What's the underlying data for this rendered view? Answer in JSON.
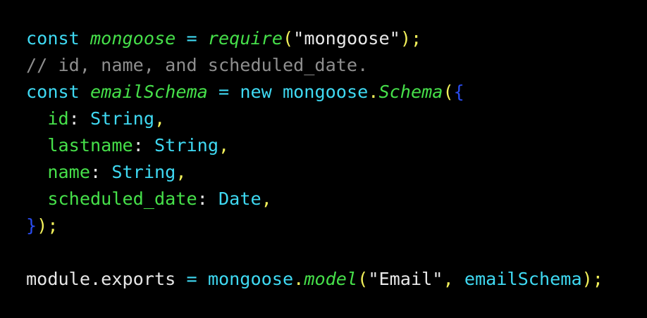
{
  "colors": {
    "background": "#000000",
    "keyword": "#3fd9f2",
    "identifier": "#46e04a",
    "string": "#e8e8e8",
    "punctuation": "#f2f05a",
    "comment": "#8e8e8e",
    "type": "#3fd9f2",
    "brace": "#2a4cf0",
    "plain": "#e6e6e6"
  },
  "lines": [
    [
      {
        "t": "const",
        "c": "keyword"
      },
      {
        "t": " ",
        "c": "plain"
      },
      {
        "t": "mongoose",
        "c": "identifier",
        "i": true
      },
      {
        "t": " = ",
        "c": "keyword"
      },
      {
        "t": "require",
        "c": "identifier",
        "i": true
      },
      {
        "t": "(",
        "c": "punctuation"
      },
      {
        "t": "\"mongoose\"",
        "c": "string"
      },
      {
        "t": ");",
        "c": "punctuation"
      }
    ],
    [
      {
        "t": "// id, name, and scheduled_date.",
        "c": "comment"
      }
    ],
    [
      {
        "t": "const",
        "c": "keyword"
      },
      {
        "t": " ",
        "c": "plain"
      },
      {
        "t": "emailSchema",
        "c": "identifier",
        "i": true
      },
      {
        "t": " = ",
        "c": "keyword"
      },
      {
        "t": "new mongoose",
        "c": "keyword"
      },
      {
        "t": ".",
        "c": "punctuation"
      },
      {
        "t": "Schema",
        "c": "identifier",
        "i": true
      },
      {
        "t": "(",
        "c": "punctuation"
      },
      {
        "t": "{",
        "c": "brace"
      }
    ],
    [
      {
        "t": "  id",
        "c": "identifier"
      },
      {
        "t": ": ",
        "c": "plain"
      },
      {
        "t": "String",
        "c": "type"
      },
      {
        "t": ",",
        "c": "punctuation"
      }
    ],
    [
      {
        "t": "  lastname",
        "c": "identifier"
      },
      {
        "t": ": ",
        "c": "plain"
      },
      {
        "t": "String",
        "c": "type"
      },
      {
        "t": ",",
        "c": "punctuation"
      }
    ],
    [
      {
        "t": "  name",
        "c": "identifier"
      },
      {
        "t": ": ",
        "c": "plain"
      },
      {
        "t": "String",
        "c": "type"
      },
      {
        "t": ",",
        "c": "punctuation"
      }
    ],
    [
      {
        "t": "  scheduled_date",
        "c": "identifier"
      },
      {
        "t": ": ",
        "c": "plain"
      },
      {
        "t": "Date",
        "c": "type"
      },
      {
        "t": ",",
        "c": "punctuation"
      }
    ],
    [
      {
        "t": "}",
        "c": "brace"
      },
      {
        "t": ");",
        "c": "punctuation"
      }
    ],
    [],
    [
      {
        "t": "module.exports",
        "c": "plain"
      },
      {
        "t": " = ",
        "c": "keyword"
      },
      {
        "t": "mongoose",
        "c": "keyword"
      },
      {
        "t": ".",
        "c": "punctuation"
      },
      {
        "t": "model",
        "c": "identifier",
        "i": true
      },
      {
        "t": "(",
        "c": "punctuation"
      },
      {
        "t": "\"Email\"",
        "c": "string"
      },
      {
        "t": ", ",
        "c": "punctuation"
      },
      {
        "t": "emailSchema",
        "c": "keyword"
      },
      {
        "t": ");",
        "c": "punctuation"
      }
    ]
  ]
}
